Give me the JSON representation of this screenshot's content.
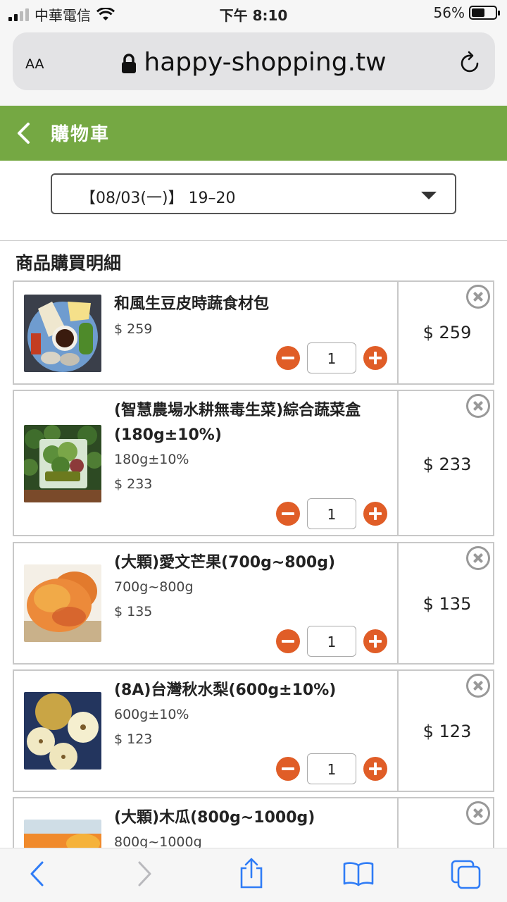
{
  "status": {
    "carrier": "中華電信",
    "time": "下午 8:10",
    "battery_pct": "56%",
    "battery_level": 0.56
  },
  "browser": {
    "text_size_label": "AA",
    "url": "happy-shopping.tw"
  },
  "header": {
    "title": "購物車"
  },
  "delivery": {
    "selected_slot": "【08/03(一)】 19–20"
  },
  "section": {
    "title": "商品購買明細"
  },
  "items": [
    {
      "name": "和風生豆皮時蔬食材包",
      "spec": "",
      "unit_price": "$ 259",
      "quantity": "1",
      "total": "$ 259",
      "image": "tofu-skin-veg-pack"
    },
    {
      "name": "(智慧農場水耕無毒生菜)綜合蔬菜盒(180g±10%)",
      "spec": "180g±10%",
      "unit_price": "$ 233",
      "quantity": "1",
      "total": "$ 233",
      "image": "hydroponic-lettuce-box"
    },
    {
      "name": "(大顆)愛文芒果(700g~800g)",
      "spec": "700g~800g",
      "unit_price": "$ 135",
      "quantity": "1",
      "total": "$ 135",
      "image": "irwin-mango"
    },
    {
      "name": "(8A)台灣秋水梨(600g±10%)",
      "spec": "600g±10%",
      "unit_price": "$ 123",
      "quantity": "1",
      "total": "$ 123",
      "image": "asian-pear"
    },
    {
      "name": "(大顆)木瓜(800g~1000g)",
      "spec": "800g~1000g",
      "unit_price": "",
      "quantity": "",
      "total": "",
      "image": "papaya"
    }
  ],
  "colors": {
    "header_green": "#75a843",
    "accent_orange": "#e05d27",
    "ios_blue": "#2f7cf6"
  }
}
